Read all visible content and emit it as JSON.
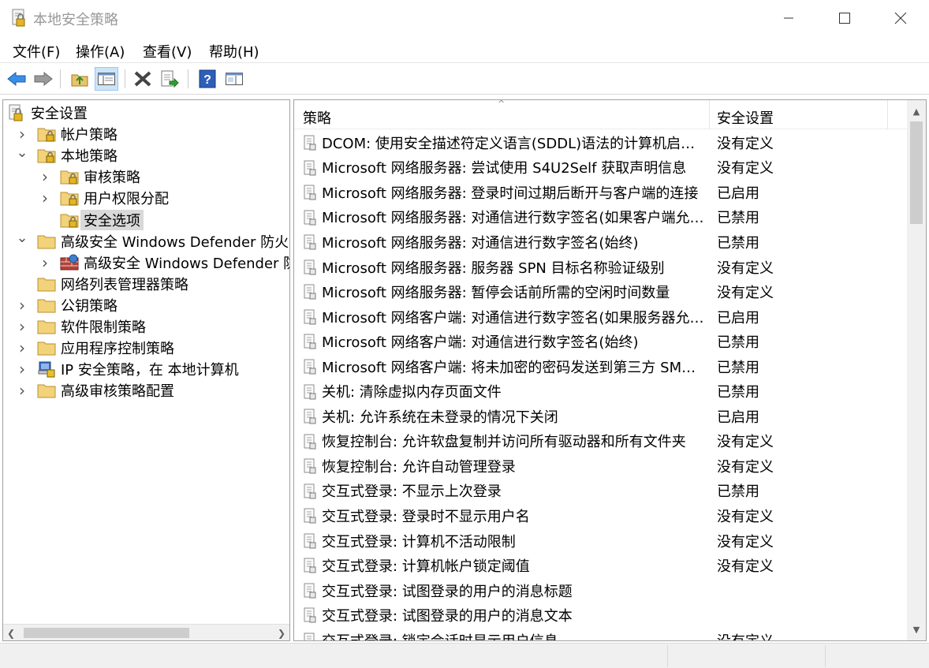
{
  "window": {
    "title": "本地安全策略",
    "icon": "policy-app-icon",
    "controls": [
      "minimize-icon",
      "maximize-icon",
      "close-icon"
    ]
  },
  "menubar": [
    {
      "label": "文件(F)"
    },
    {
      "label": "操作(A)"
    },
    {
      "label": "查看(V)"
    },
    {
      "label": "帮助(H)"
    }
  ],
  "toolbar": [
    {
      "icon": "back-arrow-icon"
    },
    {
      "icon": "forward-arrow-icon"
    },
    {
      "icon": "up-folder-icon"
    },
    {
      "icon": "show-hide-tree-icon",
      "active": true
    },
    {
      "icon": "delete-icon"
    },
    {
      "icon": "export-list-icon"
    },
    {
      "icon": "help-icon"
    },
    {
      "icon": "properties-icon"
    }
  ],
  "tree": [
    {
      "label": "安全设置",
      "level": 0,
      "icon": "security-settings-icon",
      "expander": ""
    },
    {
      "label": "帐户策略",
      "level": 1,
      "icon": "locked-folder-icon",
      "expander": "collapsed"
    },
    {
      "label": "本地策略",
      "level": 1,
      "icon": "locked-folder-icon",
      "expander": "expanded"
    },
    {
      "label": "审核策略",
      "level": 2,
      "icon": "locked-folder-icon",
      "expander": "collapsed"
    },
    {
      "label": "用户权限分配",
      "level": 2,
      "icon": "locked-folder-icon",
      "expander": "collapsed"
    },
    {
      "label": "安全选项",
      "level": 2,
      "icon": "locked-folder-icon",
      "expander": "",
      "selected": true
    },
    {
      "label": "高级安全 Windows Defender 防火墙",
      "level": 1,
      "icon": "folder-icon",
      "expander": "expanded"
    },
    {
      "label": "高级安全 Windows Defender 防火墙 - 本地组策略对象",
      "level": 2,
      "icon": "firewall-icon",
      "expander": "collapsed"
    },
    {
      "label": "网络列表管理器策略",
      "level": 1,
      "icon": "folder-icon",
      "expander": ""
    },
    {
      "label": "公钥策略",
      "level": 1,
      "icon": "folder-icon",
      "expander": "collapsed"
    },
    {
      "label": "软件限制策略",
      "level": 1,
      "icon": "folder-icon",
      "expander": "collapsed"
    },
    {
      "label": "应用程序控制策略",
      "level": 1,
      "icon": "folder-icon",
      "expander": "collapsed"
    },
    {
      "label": "IP 安全策略，在 本地计算机",
      "level": 1,
      "icon": "ip-security-icon",
      "expander": "collapsed"
    },
    {
      "label": "高级审核策略配置",
      "level": 1,
      "icon": "folder-icon",
      "expander": "collapsed"
    }
  ],
  "list": {
    "columns": [
      "策略",
      "安全设置"
    ],
    "rows": [
      {
        "policy": "DCOM: 使用安全描述符定义语言(SDDL)语法的计算机启动...",
        "setting": "没有定义"
      },
      {
        "policy": "Microsoft 网络服务器: 尝试使用 S4U2Self 获取声明信息",
        "setting": "没有定义"
      },
      {
        "policy": "Microsoft 网络服务器: 登录时间过期后断开与客户端的连接",
        "setting": "已启用"
      },
      {
        "policy": "Microsoft 网络服务器: 对通信进行数字签名(如果客户端允许)",
        "setting": "已禁用"
      },
      {
        "policy": "Microsoft 网络服务器: 对通信进行数字签名(始终)",
        "setting": "已禁用"
      },
      {
        "policy": "Microsoft 网络服务器: 服务器 SPN 目标名称验证级别",
        "setting": "没有定义"
      },
      {
        "policy": "Microsoft 网络服务器: 暂停会话前所需的空闲时间数量",
        "setting": "没有定义"
      },
      {
        "policy": "Microsoft 网络客户端: 对通信进行数字签名(如果服务器允许)",
        "setting": "已启用"
      },
      {
        "policy": "Microsoft 网络客户端: 对通信进行数字签名(始终)",
        "setting": "已禁用"
      },
      {
        "policy": "Microsoft 网络客户端: 将未加密的密码发送到第三方 SMB ...",
        "setting": "已禁用"
      },
      {
        "policy": "关机: 清除虚拟内存页面文件",
        "setting": "已禁用"
      },
      {
        "policy": "关机: 允许系统在未登录的情况下关闭",
        "setting": "已启用"
      },
      {
        "policy": "恢复控制台: 允许软盘复制并访问所有驱动器和所有文件夹",
        "setting": "没有定义"
      },
      {
        "policy": "恢复控制台: 允许自动管理登录",
        "setting": "没有定义"
      },
      {
        "policy": "交互式登录: 不显示上次登录",
        "setting": "已禁用"
      },
      {
        "policy": "交互式登录: 登录时不显示用户名",
        "setting": "没有定义"
      },
      {
        "policy": "交互式登录: 计算机不活动限制",
        "setting": "没有定义"
      },
      {
        "policy": "交互式登录: 计算机帐户锁定阈值",
        "setting": "没有定义"
      },
      {
        "policy": "交互式登录: 试图登录的用户的消息标题",
        "setting": ""
      },
      {
        "policy": "交互式登录: 试图登录的用户的消息文本",
        "setting": ""
      },
      {
        "policy": "交互式登录: 锁定会话时显示用户信息",
        "setting": "没有定义"
      }
    ]
  }
}
